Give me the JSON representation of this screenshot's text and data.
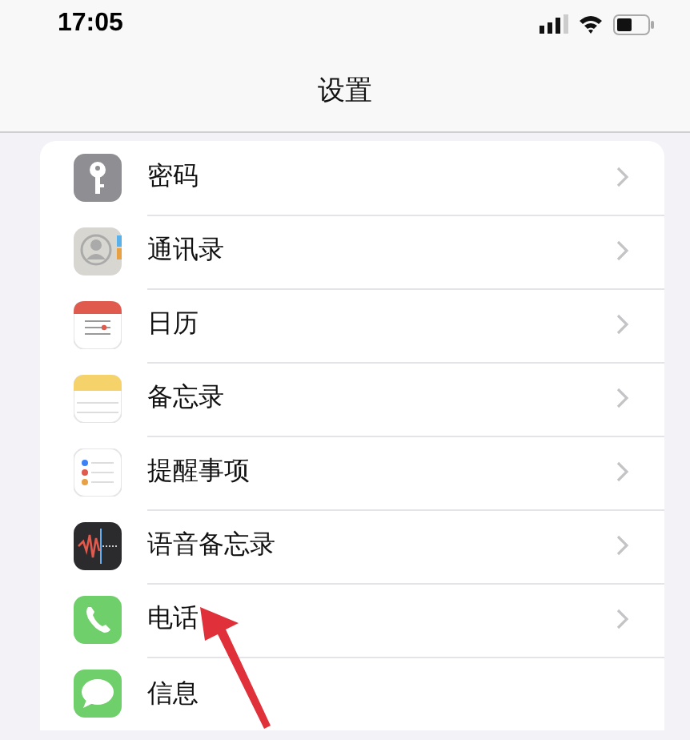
{
  "status_bar": {
    "time": "17:05"
  },
  "nav": {
    "title": "设置"
  },
  "rows": [
    {
      "label": "密码"
    },
    {
      "label": "通讯录"
    },
    {
      "label": "日历"
    },
    {
      "label": "备忘录"
    },
    {
      "label": "提醒事项"
    },
    {
      "label": "语音备忘录"
    },
    {
      "label": "电话"
    },
    {
      "label": "信息"
    }
  ]
}
